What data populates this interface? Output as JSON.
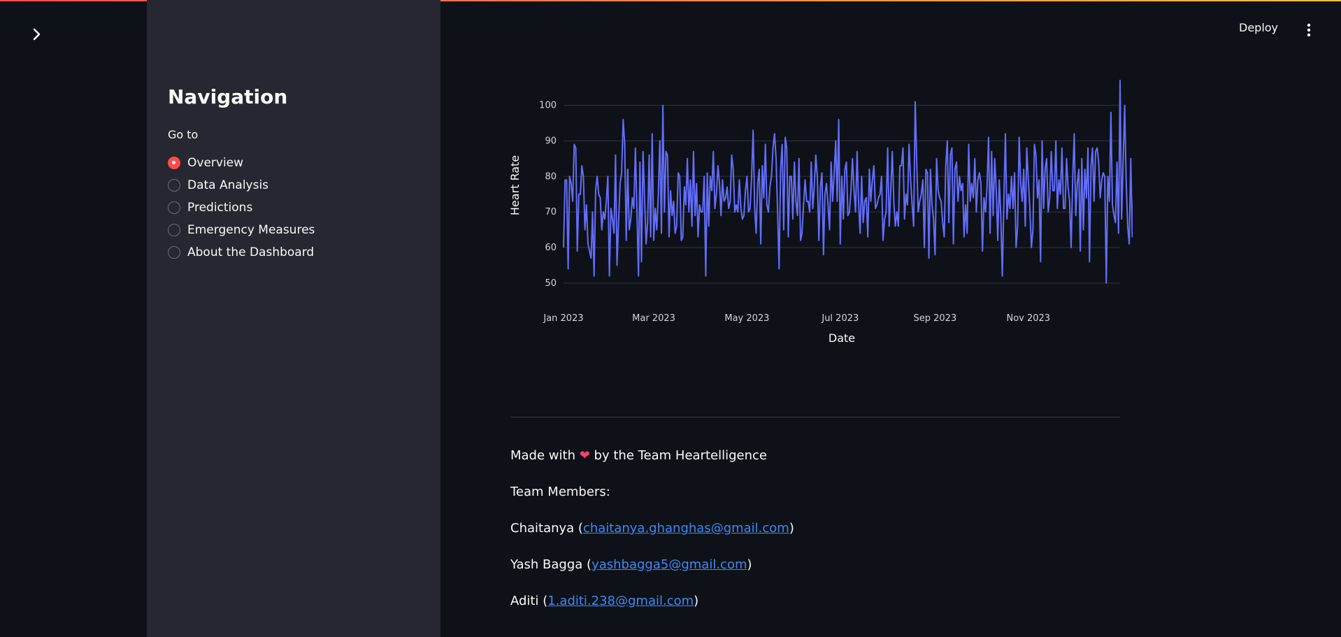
{
  "header": {
    "deploy_label": "Deploy",
    "expand_icon": "chevron-right-icon",
    "menu_icon": "more-vertical-icon"
  },
  "sidebar": {
    "title": "Navigation",
    "radio_label": "Go to",
    "options": [
      {
        "label": "Overview",
        "selected": true
      },
      {
        "label": "Data Analysis",
        "selected": false
      },
      {
        "label": "Predictions",
        "selected": false
      },
      {
        "label": "Emergency Measures",
        "selected": false
      },
      {
        "label": "About the Dashboard",
        "selected": false
      }
    ]
  },
  "colors": {
    "background": "#0e1117",
    "sidebar": "#262730",
    "accent": "#ff4b4b",
    "series": "#636efa",
    "link": "#3d8af7"
  },
  "chart_data": {
    "type": "line",
    "xlabel": "Date",
    "ylabel": "Heart Rate",
    "ylim": [
      48,
      107
    ],
    "yticks": [
      50,
      60,
      70,
      80,
      90,
      100
    ],
    "xticks": [
      "Jan 2023",
      "Mar 2023",
      "May 2023",
      "Jul 2023",
      "Sep 2023",
      "Nov 2023"
    ],
    "xtick_dates": [
      "2023-01-01",
      "2023-03-01",
      "2023-05-01",
      "2023-07-01",
      "2023-09-01",
      "2023-11-01"
    ],
    "xrange": [
      "2023-01-01",
      "2023-12-31"
    ],
    "grid": true,
    "x_start": "2023-01-01",
    "values": [
      60,
      79,
      79,
      54,
      80,
      78,
      73,
      89,
      88,
      59,
      75,
      75,
      83,
      80,
      65,
      72,
      61,
      59,
      57,
      70,
      52,
      76,
      80,
      75,
      74,
      65,
      70,
      68,
      73,
      80,
      52,
      71,
      68,
      64,
      86,
      55,
      67,
      78,
      81,
      96,
      89,
      62,
      82,
      65,
      68,
      74,
      71,
      88,
      70,
      52,
      84,
      56,
      87,
      74,
      61,
      67,
      86,
      63,
      92,
      62,
      71,
      65,
      75,
      90,
      64,
      100,
      70,
      87,
      86,
      63,
      76,
      69,
      73,
      64,
      66,
      81,
      80,
      62,
      63,
      77,
      72,
      85,
      70,
      79,
      66,
      87,
      69,
      78,
      63,
      72,
      70,
      70,
      80,
      52,
      81,
      66,
      80,
      76,
      87,
      71,
      75,
      83,
      78,
      69,
      79,
      73,
      74,
      77,
      71,
      73,
      86,
      82,
      70,
      72,
      70,
      79,
      71,
      68,
      69,
      76,
      80,
      70,
      71,
      80,
      93,
      71,
      64,
      78,
      82,
      61,
      83,
      74,
      89,
      72,
      70,
      77,
      80,
      88,
      92,
      85,
      70,
      54,
      82,
      89,
      65,
      91,
      88,
      63,
      80,
      80,
      68,
      84,
      73,
      69,
      85,
      62,
      64,
      72,
      79,
      73,
      73,
      70,
      84,
      71,
      77,
      86,
      80,
      62,
      77,
      81,
      58,
      75,
      78,
      72,
      65,
      84,
      73,
      81,
      90,
      73,
      96,
      61,
      80,
      68,
      82,
      84,
      69,
      70,
      76,
      85,
      76,
      70,
      87,
      72,
      64,
      80,
      67,
      73,
      74,
      63,
      82,
      73,
      79,
      83,
      71,
      72,
      74,
      75,
      80,
      62,
      68,
      70,
      88,
      66,
      76,
      87,
      73,
      66,
      70,
      66,
      83,
      83,
      88,
      68,
      75,
      72,
      89,
      79,
      72,
      66,
      101,
      84,
      70,
      73,
      75,
      79,
      60,
      82,
      81,
      57,
      82,
      72,
      68,
      58,
      85,
      76,
      74,
      73,
      67,
      63,
      83,
      90,
      67,
      86,
      88,
      61,
      82,
      84,
      73,
      80,
      76,
      78,
      63,
      72,
      64,
      89,
      73,
      78,
      74,
      85,
      70,
      79,
      81,
      78,
      59,
      74,
      70,
      77,
      91,
      64,
      87,
      69,
      85,
      76,
      62,
      79,
      69,
      52,
      73,
      92,
      68,
      75,
      71,
      80,
      71,
      81,
      60,
      66,
      91,
      78,
      73,
      82,
      66,
      88,
      79,
      71,
      60,
      65,
      89,
      86,
      74,
      79,
      56,
      90,
      71,
      82,
      85,
      70,
      74,
      87,
      76,
      76,
      90,
      71,
      79,
      75,
      88,
      71,
      71,
      85,
      77,
      73,
      60,
      79,
      92,
      69,
      78,
      82,
      59,
      85,
      65,
      82,
      74,
      88,
      56,
      83,
      88,
      73,
      87,
      88,
      84,
      74,
      79,
      81,
      80,
      50,
      80,
      73,
      98,
      72,
      69,
      67,
      84,
      64,
      107,
      68,
      84,
      100,
      79,
      66,
      61,
      85,
      63,
      80,
      71,
      81,
      60,
      90,
      63,
      87,
      69,
      66,
      71,
      73,
      80,
      61,
      76,
      74,
      68,
      78,
      80,
      63,
      87,
      77,
      60,
      60,
      70,
      68,
      69,
      71,
      71,
      80,
      78,
      62,
      86
    ]
  },
  "footer": {
    "made_prefix": "Made with",
    "heart": "❤",
    "made_suffix": "by the Team Heartelligence",
    "team_label": "Team Members:",
    "members": [
      {
        "name": "Chaitanya",
        "email": "chaitanya.ghanghas@gmail.com"
      },
      {
        "name": "Yash Bagga",
        "email": "yashbagga5@gmail.com"
      },
      {
        "name": "Aditi",
        "email": "1.aditi.238@gmail.com"
      }
    ]
  }
}
